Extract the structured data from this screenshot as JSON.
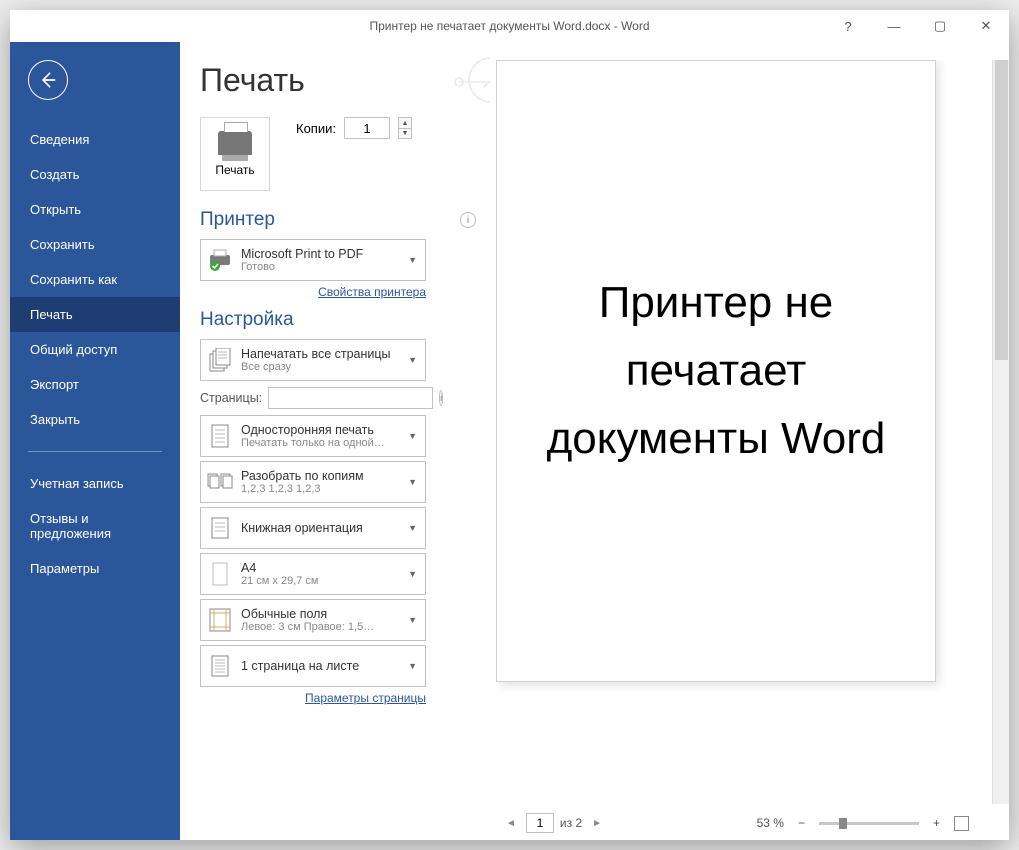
{
  "titlebar": {
    "title": "Принтер не печатает документы Word.docx  -  Word"
  },
  "sidebar": {
    "items": [
      "Сведения",
      "Создать",
      "Открыть",
      "Сохранить",
      "Сохранить как",
      "Печать",
      "Общий доступ",
      "Экспорт",
      "Закрыть"
    ],
    "group2": [
      "Учетная запись",
      "Отзывы и предложения",
      "Параметры"
    ],
    "active_index": 5
  },
  "heading": "Печать",
  "print_button": "Печать",
  "copies": {
    "label": "Копии:",
    "value": "1"
  },
  "printer_section": {
    "title": "Принтер",
    "selected": {
      "name": "Microsoft Print to PDF",
      "status": "Готово"
    },
    "properties_link": "Свойства принтера"
  },
  "settings_section": {
    "title": "Настройка",
    "print_range": {
      "l1": "Напечатать все страницы",
      "l2": "Все сразу"
    },
    "pages_label": "Страницы:",
    "pages_value": "",
    "duplex": {
      "l1": "Односторонняя печать",
      "l2": "Печатать только на одной…"
    },
    "collate": {
      "l1": "Разобрать по копиям",
      "l2": "1,2,3   1,2,3   1,2,3"
    },
    "orientation": {
      "l1": "Книжная ориентация"
    },
    "paper": {
      "l1": "A4",
      "l2": "21 см x 29,7 см"
    },
    "margins": {
      "l1": "Обычные поля",
      "l2": "Левое:  3 см   Правое:  1,5…"
    },
    "per_sheet": {
      "l1": "1 страница на листе"
    },
    "page_setup_link": "Параметры страницы"
  },
  "preview": {
    "text": "Принтер не печатает документы Word",
    "page_current": "1",
    "page_total": "из 2",
    "zoom": "53 %"
  }
}
